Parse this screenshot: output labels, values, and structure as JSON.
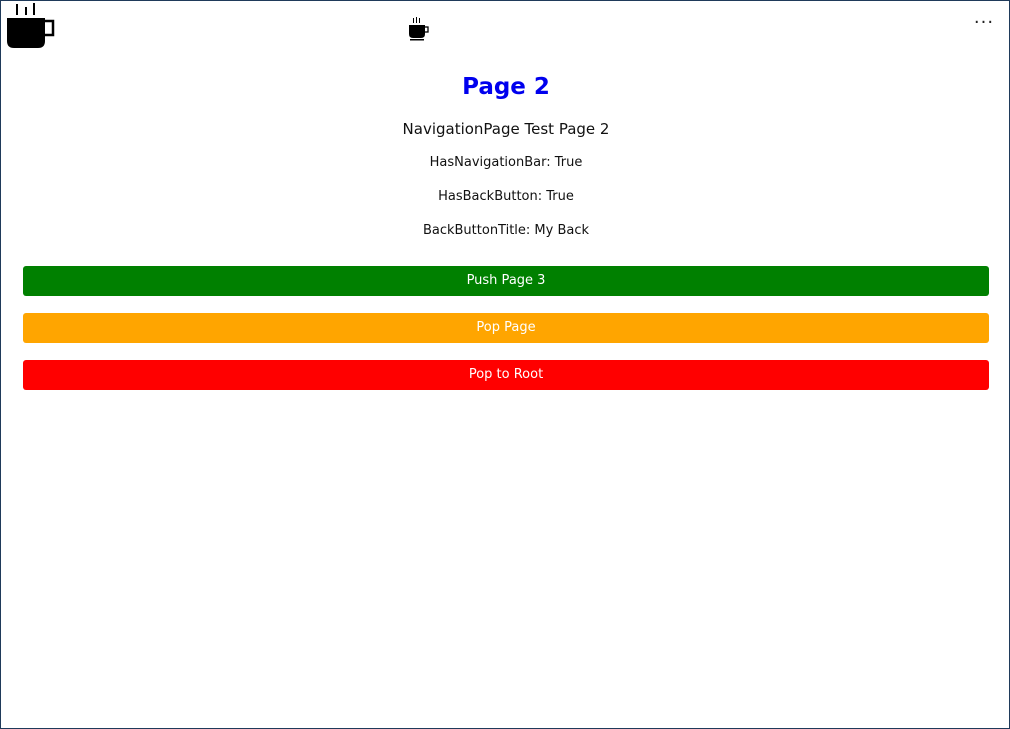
{
  "header": {
    "app_icon": "coffee-cup-icon",
    "title_icon": "coffee-cup-icon",
    "more_label": "···"
  },
  "content": {
    "title": "Page 2",
    "subtitle": "NavigationPage Test Page 2",
    "has_navigation_bar": "HasNavigationBar: True",
    "has_back_button": "HasBackButton: True",
    "back_button_title": "BackButtonTitle: My Back"
  },
  "buttons": {
    "push": "Push Page 3",
    "pop": "Pop Page",
    "pop_root": "Pop to Root"
  },
  "colors": {
    "title": "#0000ee",
    "push": "#008000",
    "pop": "#ffa500",
    "pop_root": "#ff0000"
  }
}
